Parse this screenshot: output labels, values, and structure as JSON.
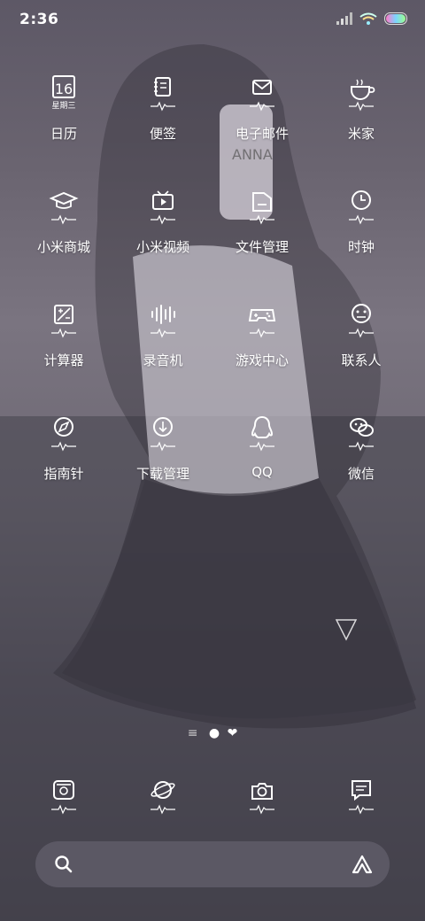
{
  "status": {
    "time": "2:36"
  },
  "calendar": {
    "date": "16",
    "weekday": "星期三"
  },
  "apps": [
    {
      "label": "日历",
      "icon": "calendar-icon"
    },
    {
      "label": "便签",
      "icon": "notes-icon"
    },
    {
      "label": "电子邮件",
      "icon": "mail-icon"
    },
    {
      "label": "米家",
      "icon": "mijia-icon"
    },
    {
      "label": "小米商城",
      "icon": "store-icon"
    },
    {
      "label": "小米视频",
      "icon": "video-icon"
    },
    {
      "label": "文件管理",
      "icon": "files-icon"
    },
    {
      "label": "时钟",
      "icon": "clock-icon"
    },
    {
      "label": "计算器",
      "icon": "calculator-icon"
    },
    {
      "label": "录音机",
      "icon": "recorder-icon"
    },
    {
      "label": "游戏中心",
      "icon": "gamepad-icon"
    },
    {
      "label": "联系人",
      "icon": "contacts-icon"
    },
    {
      "label": "指南针",
      "icon": "compass-icon"
    },
    {
      "label": "下载管理",
      "icon": "download-icon"
    },
    {
      "label": "QQ",
      "icon": "qq-icon"
    },
    {
      "label": "微信",
      "icon": "wechat-icon"
    }
  ],
  "dock": [
    {
      "icon": "phone-icon"
    },
    {
      "icon": "browser-icon"
    },
    {
      "icon": "camera-icon"
    },
    {
      "icon": "messages-icon"
    }
  ],
  "page_indicator": {
    "current": 1,
    "total": 2
  }
}
